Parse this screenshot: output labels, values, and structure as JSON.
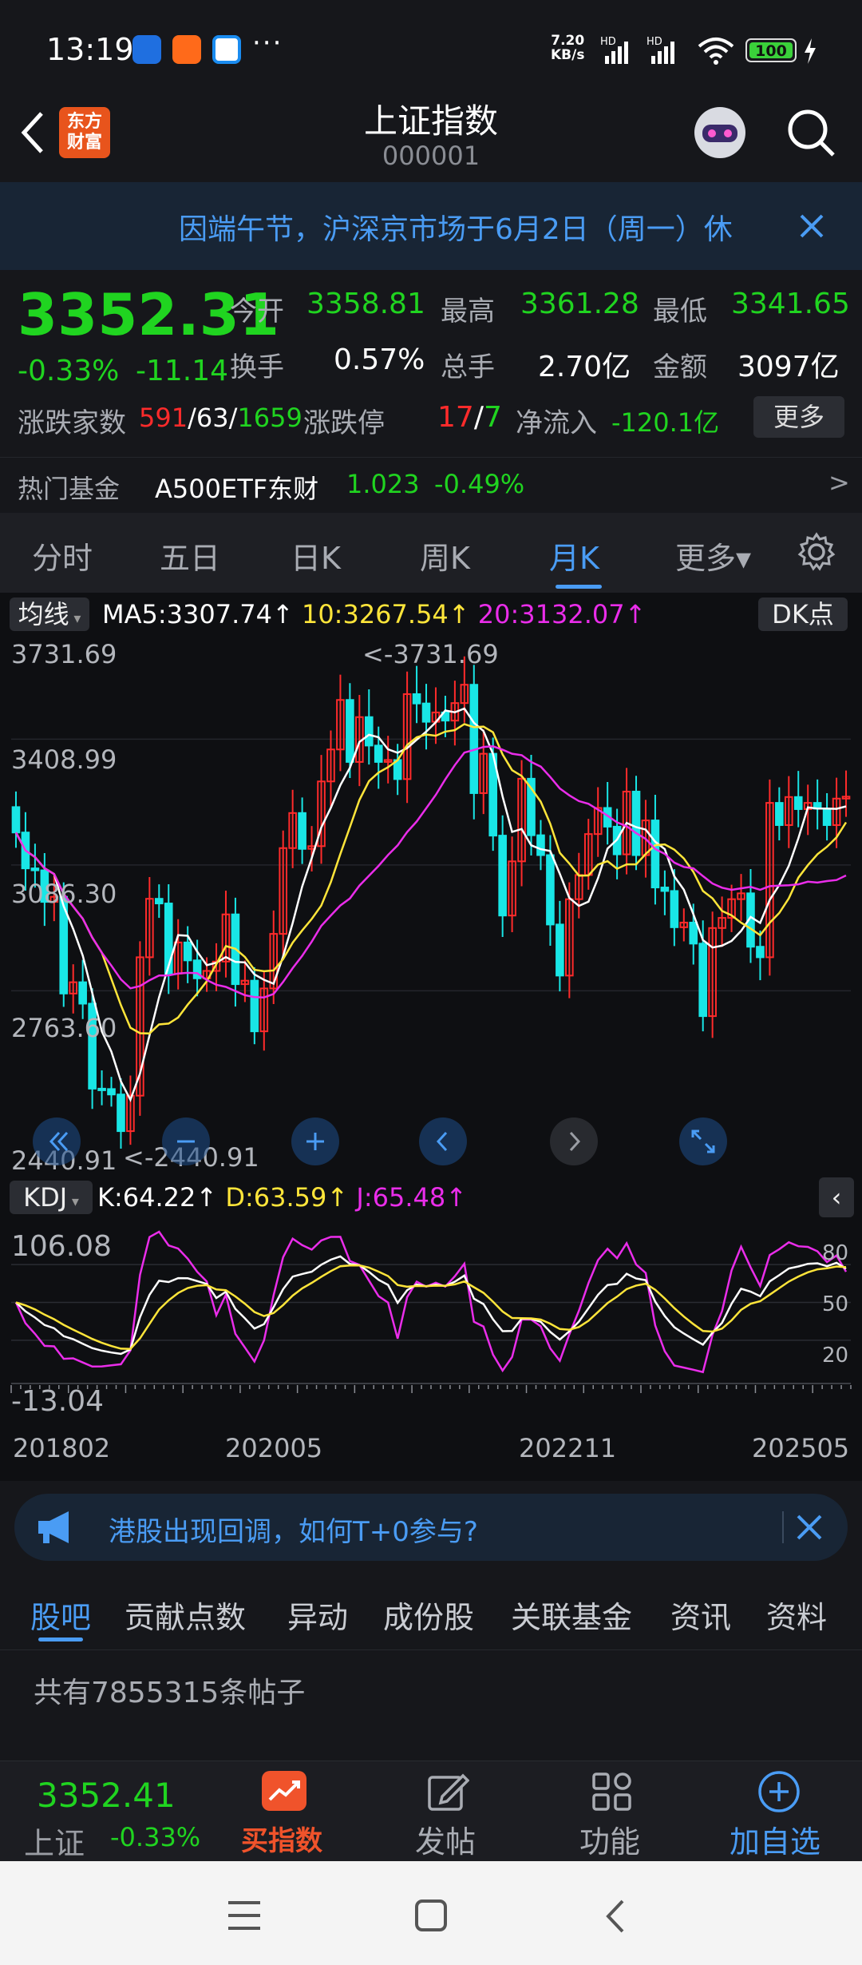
{
  "status": {
    "time": "13:19",
    "dots": "···",
    "speed_value": "7.20",
    "speed_unit": "KB/s",
    "battery": "100"
  },
  "nav": {
    "title": "上证指数",
    "code": "000001",
    "logo_line1": "东方",
    "logo_line2": "财富"
  },
  "notice": {
    "text": "因端午节，沪深京市场于6月2日（周一）休"
  },
  "quote": {
    "price": "3352.31",
    "change_pct": "-0.33%",
    "change": "-11.14",
    "open_label": "今开",
    "open": "3358.81",
    "high_label": "最高",
    "high": "3361.28",
    "low_label": "最低",
    "low": "3341.65",
    "turnover_label": "换手",
    "turnover": "0.57%",
    "volume_label": "总手",
    "volume": "2.70亿",
    "amount_label": "金额",
    "amount": "3097亿",
    "breadth_label": "涨跌家数",
    "up": "591",
    "flat": "63",
    "down": "1659",
    "limit_label": "涨跌停",
    "limit_up": "17",
    "limit_down": "7",
    "inflow_label": "净流入",
    "inflow": "-120.1亿",
    "more": "更多"
  },
  "fund": {
    "label": "热门基金",
    "name": "A500ETF东财",
    "price": "1.023",
    "change": "-0.49%"
  },
  "ktabs": [
    "分时",
    "五日",
    "日K",
    "周K",
    "月K",
    "更多▾"
  ],
  "ktab_active": "月K",
  "chart": {
    "ma_btn": "均线",
    "ma5": "MA5:3307.74↑",
    "ma10": "10:3267.54↑",
    "ma20": "20:3132.07↑",
    "dk_btn": "DK点",
    "y_ticks": [
      "3731.69",
      "3408.99",
      "3086.30",
      "2763.60",
      "2440.91"
    ],
    "max_note": "<-3731.69",
    "min_note": "<-2440.91",
    "kdj_btn": "KDJ",
    "k": "K:64.22↑",
    "d": "D:63.59↑",
    "j": "J:65.48↑",
    "kdj_top": "106.08",
    "kdj_bottom": "-13.04",
    "kdj_levels": [
      "80",
      "50",
      "20"
    ],
    "x_ticks": [
      "201802",
      "202005",
      "202211",
      "202505"
    ],
    "colors": {
      "up": "#ff2b2b",
      "down": "#19e6e6",
      "ma5": "#ffffff",
      "ma10": "#ffe53a",
      "ma20": "#ea2dea"
    }
  },
  "chart_data": {
    "type": "candlestick",
    "period": "monthly",
    "x_range": [
      "201802",
      "202505"
    ],
    "ylim": [
      2440.91,
      3731.69
    ],
    "max": 3731.69,
    "min": 2440.91,
    "ma": {
      "MA5": 3307.74,
      "MA10": 3267.54,
      "MA20": 3132.07
    },
    "kdj": {
      "K": 64.22,
      "D": 63.59,
      "J": 65.48,
      "ylim": [
        -13.04,
        106.08
      ]
    },
    "close_series": [
      3260,
      3168,
      3163,
      3082,
      3095,
      2847,
      2876,
      2821,
      2603,
      2602,
      2588,
      2494,
      2585,
      2940,
      3090,
      3078,
      2898,
      2978,
      2932,
      2886,
      2905,
      2929,
      3050,
      2871,
      2880,
      2750,
      2860,
      3000,
      3220,
      3310,
      3218,
      3225,
      3391,
      3473,
      3600,
      3441,
      3556,
      3483,
      3441,
      3446,
      3397,
      3615,
      3591,
      3544,
      3568,
      3547,
      3592,
      3639,
      3361,
      3462,
      3252,
      3047,
      3186,
      3398,
      3253,
      3202,
      3024,
      2893,
      3089,
      3151,
      3256,
      3323,
      3275,
      3204,
      3365,
      3202,
      3291,
      3119,
      3110,
      3017,
      3029,
      2975,
      2789,
      3015,
      3041,
      3089,
      3104,
      2967,
      2940,
      3336,
      3279,
      3351,
      3320,
      3336,
      3321,
      3279,
      3347,
      3352
    ]
  },
  "promo": {
    "text": "港股出现回调，如何T+0参与?"
  },
  "btabs": [
    "股吧",
    "贡献点数",
    "异动",
    "成份股",
    "关联基金",
    "资讯",
    "资料"
  ],
  "btab_active": "股吧",
  "posts": "共有7855315条帖子",
  "bottom": {
    "index_price": "3352.41",
    "index_name": "上证",
    "index_change": "-0.33%",
    "buy": "买指数",
    "post": "发帖",
    "func": "功能",
    "add": "加自选"
  }
}
